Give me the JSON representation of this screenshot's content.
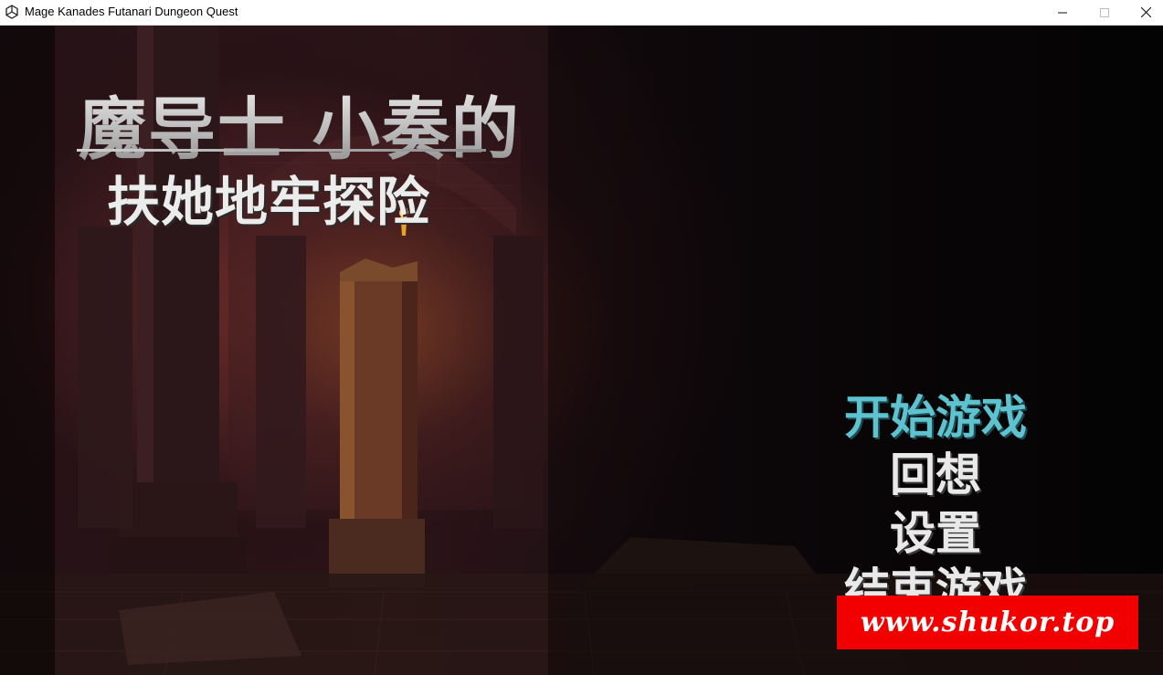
{
  "window": {
    "title": "Mage Kanades Futanari Dungeon Quest",
    "icon": "unity-icon",
    "controls": [
      "minimize-icon",
      "maximize-icon",
      "close-icon"
    ]
  },
  "game": {
    "title_line1": "魔导士 小奏的",
    "title_line2": "扶她地牢探险"
  },
  "menu": {
    "items": [
      {
        "label": "开始游戏",
        "selected": true
      },
      {
        "label": "回想",
        "selected": false
      },
      {
        "label": "设置",
        "selected": false
      },
      {
        "label": "结束游戏",
        "selected": false
      }
    ]
  },
  "watermark": {
    "text": "www.shukor.top"
  },
  "colors": {
    "selected_menu": "#5fc3cf",
    "menu_text": "#e9e9e9",
    "watermark_bg": "#f20000"
  }
}
